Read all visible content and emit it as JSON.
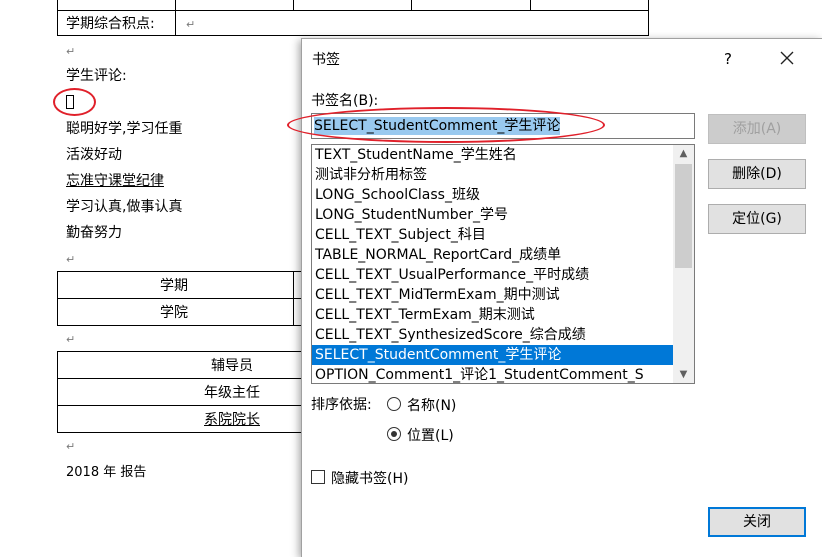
{
  "document": {
    "top_row_label": "学期综合积点:",
    "comment_label": "学生评论:",
    "comments": [
      "聪明好学,学习任重",
      "活泼好动",
      "忘准守课堂纪律",
      "学习认真,做事认真",
      "勤奋努力"
    ],
    "table1": [
      "学期",
      "学院"
    ],
    "table2": [
      "辅导员",
      "年级主任",
      "系院院长"
    ],
    "footer": "2018 年  报告",
    "para_mark": "↵",
    "return_mark": "↵"
  },
  "dialog": {
    "title": "书签",
    "help": "?",
    "name_label": "书签名(B):",
    "name_value": "SELECT_StudentComment_学生评论",
    "bookmarks": [
      "TEXT_StudentName_学生姓名",
      "测试非分析用标签",
      "LONG_SchoolClass_班级",
      "LONG_StudentNumber_学号",
      "CELL_TEXT_Subject_科目",
      "TABLE_NORMAL_ReportCard_成绩单",
      "CELL_TEXT_UsualPerformance_平时成绩",
      "CELL_TEXT_MidTermExam_期中测试",
      "CELL_TEXT_TermExam_期末测试",
      "CELL_TEXT_SynthesizedScore_综合成绩",
      "SELECT_StudentComment_学生评论",
      "OPTION_Comment1_评论1_StudentComment_S"
    ],
    "selected_index": 10,
    "buttons": {
      "add": "添加(A)",
      "delete": "删除(D)",
      "goto": "定位(G)",
      "close": "关闭"
    },
    "sort_label": "排序依据:",
    "sort_options": {
      "name": "名称(N)",
      "location": "位置(L)"
    },
    "sort_selected": "location",
    "hidden_label": "隐藏书签(H)",
    "hidden_checked": false
  },
  "colors": {
    "selection": "#0078d7",
    "annotation": "#e0202a",
    "text_highlight": "#99c9ef"
  }
}
